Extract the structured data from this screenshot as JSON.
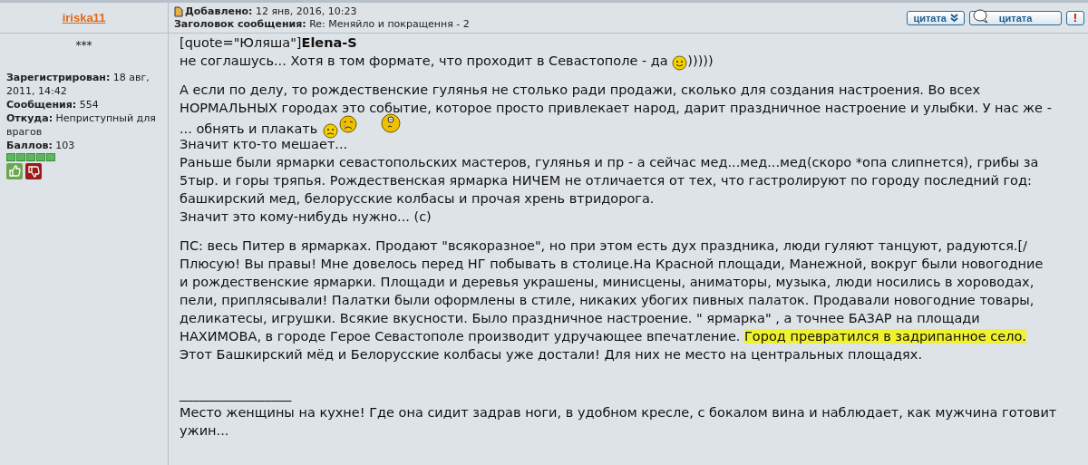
{
  "author": {
    "name": "iriska11",
    "rank": "***",
    "stats": [
      {
        "label": "Зарегистрирован:",
        "value": "18 авг, 2011, 14:42"
      },
      {
        "label": "Сообщения:",
        "value": "554"
      },
      {
        "label": "Откуда:",
        "value": "Неприступный для врагов"
      },
      {
        "label": "Баллов:",
        "value": "103"
      }
    ]
  },
  "post_header": {
    "added_label": "Добавлено:",
    "added_value": "12 янв, 2016, 10:23",
    "subject_label": "Заголовок сообщения:",
    "subject_value": "Re: Меняйло и покращення - 2"
  },
  "buttons": [
    {
      "kind": "multiquote",
      "label": "цитата"
    },
    {
      "kind": "quote",
      "label": "цитата"
    },
    {
      "kind": "report",
      "label": "!"
    }
  ],
  "body": [
    [
      {
        "kind": "text",
        "text": "[quote=\"Юляша\"]**Elena-S**"
      }
    ],
    [
      {
        "kind": "text",
        "text": "не соглашусь... Хотя в том формате, что проходит в Севастополе - да "
      },
      {
        "kind": "smile"
      },
      {
        "kind": "text",
        "text": ")))))"
      }
    ],
    [
      {
        "kind": "break"
      }
    ],
    [
      {
        "kind": "text",
        "text": "А если по делу, то рождественские гулянья не столько ради продажи, сколько для создания настроения. Во всех"
      }
    ],
    [
      {
        "kind": "text",
        "text": "НОРМАЛЬНЫХ городах это событие, которое просто привлекает народ, дарит праздничное настроение и улыбки. У нас же -"
      }
    ],
    [
      {
        "kind": "text",
        "text": "... обнять и плакать "
      },
      {
        "kind": "frown"
      },
      {
        "kind": "crying"
      },
      {
        "kind": "gap"
      },
      {
        "kind": "dizzy"
      }
    ],
    [
      {
        "kind": "text",
        "text": "Значит кто-то мешает..."
      }
    ],
    [
      {
        "kind": "text",
        "text": "Раньше были ярмарки севастопольских мастеров, гулянья и пр - а сейчас мед...мед...мед(скоро *опа слипнется), грибы за"
      }
    ],
    [
      {
        "kind": "text",
        "text": "5тыр. и горы тряпья. Рождественская ярмарка НИЧЕМ не отличается от тех, что гастролируют по городу последний год:"
      }
    ],
    [
      {
        "kind": "text",
        "text": "башкирский мед, белорусские колбасы и прочая хрень втридорога."
      }
    ],
    [
      {
        "kind": "text",
        "text": "Значит это кому-нибудь нужно... (с)"
      }
    ],
    [
      {
        "kind": "break"
      }
    ],
    [
      {
        "kind": "text",
        "text": "ПС: весь Питер в ярмарках. Продают \"всякоразное\", но при этом есть дух праздника, люди гуляют танцуют, радуются.[/"
      }
    ],
    [
      {
        "kind": "text",
        "text": "Плюсую! Вы правы! Мне довелось перед НГ побывать в столице.На Красной площади, Манежной, вокруг были новогодние"
      }
    ],
    [
      {
        "kind": "text",
        "text": "и рождественские ярмарки. Площади и деревья украшены, минисцены, аниматоры, музыка, люди носились в хороводах,"
      }
    ],
    [
      {
        "kind": "text",
        "text": "пели, приплясывали! Палатки были оформлены в стиле, никаких убогих пивных палаток. Продавали новогодние товары,"
      }
    ],
    [
      {
        "kind": "text",
        "text": "деликатесы, игрушки. Всякие вкусности. Было праздничное настроение. \" ярмарка\" , а точнее БАЗАР на площади"
      }
    ],
    [
      {
        "kind": "text",
        "text": "НАХИМОВА, в городе Герое Севастополе производит удручающее впечатление. "
      },
      {
        "kind": "marked",
        "text": "Город превратился в задрипанное село."
      }
    ],
    [
      {
        "kind": "text",
        "text": "Этот Башкирский мёд и Белорусские колбасы уже достали! Для них не место на центральных площадях."
      }
    ],
    [
      {
        "kind": "break"
      }
    ],
    [
      {
        "kind": "break"
      }
    ],
    [
      {
        "kind": "text",
        "text": "_________________"
      }
    ],
    [
      {
        "kind": "text",
        "text": "Место женщины на кухне! Где она сидит задрав ноги, в удобном кресле, с бокалом вина и наблюдает, как мужчина готовит"
      }
    ],
    [
      {
        "kind": "text",
        "text": "ужин..."
      }
    ]
  ]
}
